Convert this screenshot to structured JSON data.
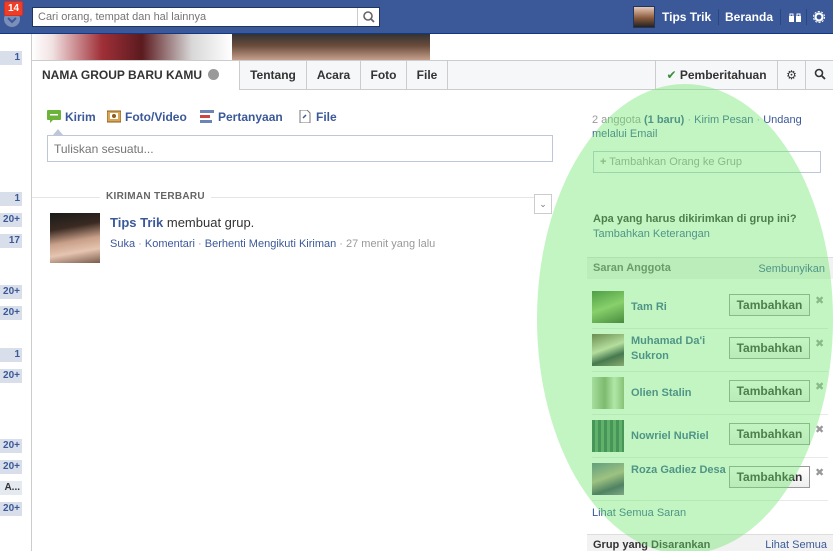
{
  "topbar": {
    "notif_count": "14",
    "search_placeholder": "Cari orang, tempat dan hal lainnya",
    "user_name": "Tips Trik",
    "home_label": "Beranda"
  },
  "leftcol": {
    "badges": [
      "1",
      "1",
      "20+",
      "17",
      "20+",
      "20+",
      "1",
      "20+",
      "20+",
      "20+",
      "A...",
      "20+"
    ]
  },
  "groupnav": {
    "title": "NAMA GROUP BARU KAMU",
    "tabs": [
      "Tentang",
      "Acara",
      "Foto",
      "File"
    ],
    "notifications_label": "Pemberitahuan"
  },
  "composer": {
    "tabs": [
      "Kirim",
      "Foto/Video",
      "Pertanyaan",
      "File"
    ],
    "placeholder": "Tuliskan sesuatu..."
  },
  "recent": {
    "label": "KIRIMAN TERBARU"
  },
  "post": {
    "author": "Tips Trik",
    "action": "membuat grup.",
    "like": "Suka",
    "comment": "Komentari",
    "unfollow": "Berhenti Mengikuti Kiriman",
    "time": "27 menit yang lalu"
  },
  "right": {
    "members_count": "2 anggota",
    "new_count": "(1 baru)",
    "send_msg": "Kirim Pesan",
    "invite_line1": "Undang",
    "invite_line2": "melalui Email",
    "add_people_placeholder": "Tambahkan Orang ke Grup",
    "question": "Apa yang harus dikirimkan di grup ini?",
    "add_desc": "Tambahkan Keterangan",
    "suggest_title": "Saran Anggota",
    "hide_label": "Sembunyikan",
    "suggestions": [
      {
        "name": "Tam Ri"
      },
      {
        "name": "Muhamad Da'i Sukron"
      },
      {
        "name": "Olien Stalin"
      },
      {
        "name": "Nowriel NuRiel"
      },
      {
        "name": "Roza Gadiez Desa"
      }
    ],
    "add_button": "Tambahkan",
    "see_all": "Lihat Semua Saran",
    "groups_title": "Grup yang Disarankan",
    "groups_see_all": "Lihat Semua"
  },
  "colors": {
    "facebook_blue": "#3b5998",
    "highlight": "#6ee66e"
  }
}
